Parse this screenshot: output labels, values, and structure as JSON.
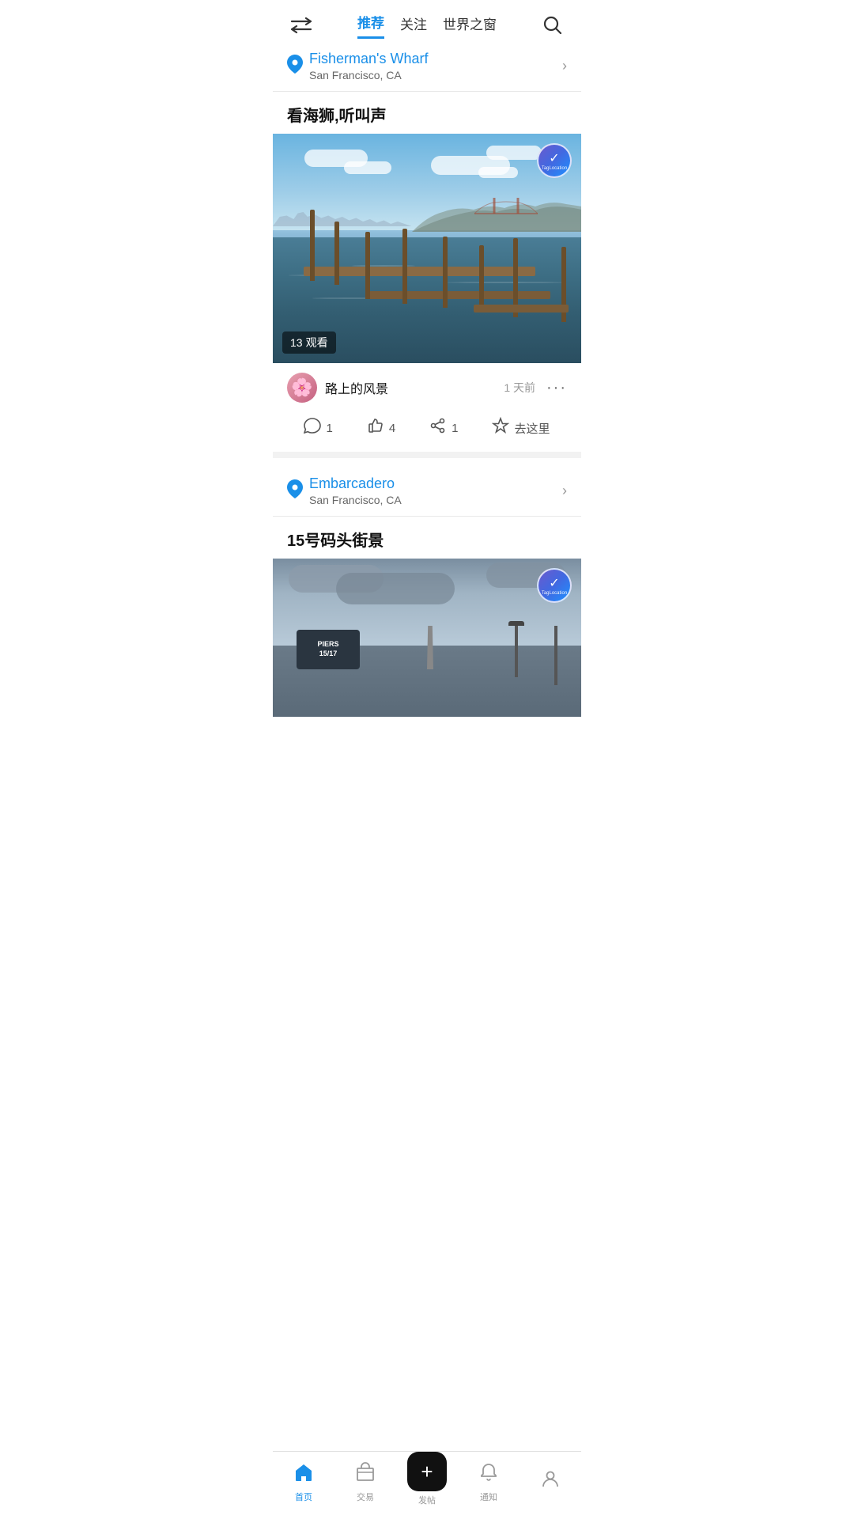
{
  "nav": {
    "tabs": [
      {
        "label": "推荐",
        "active": true
      },
      {
        "label": "关注",
        "active": false
      },
      {
        "label": "世界之窗",
        "active": false
      }
    ],
    "swap_icon": "⇄",
    "search_icon": "🔍"
  },
  "post1": {
    "location_name": "Fisherman's Wharf",
    "location_sub": "San Francisco, CA",
    "post_title": "看海狮,听叫声",
    "views_count": "13",
    "views_label": "观看",
    "verified_text": "TagLocation",
    "username": "路上的风景",
    "time_ago": "1 天前",
    "actions": {
      "comment_count": "1",
      "like_count": "4",
      "share_count": "1",
      "navigate_label": "去这里"
    }
  },
  "post2": {
    "location_name": "Embarcadero",
    "location_sub": "San Francisco, CA",
    "post_title": "15号码头街景"
  },
  "bottom_nav": {
    "items": [
      {
        "label": "首页",
        "active": true,
        "icon": "home"
      },
      {
        "label": "交易",
        "active": false,
        "icon": "shop"
      },
      {
        "label": "发帖",
        "active": false,
        "icon": "plus"
      },
      {
        "label": "通知",
        "active": false,
        "icon": "bell"
      },
      {
        "label": "",
        "active": false,
        "icon": "user"
      }
    ]
  }
}
